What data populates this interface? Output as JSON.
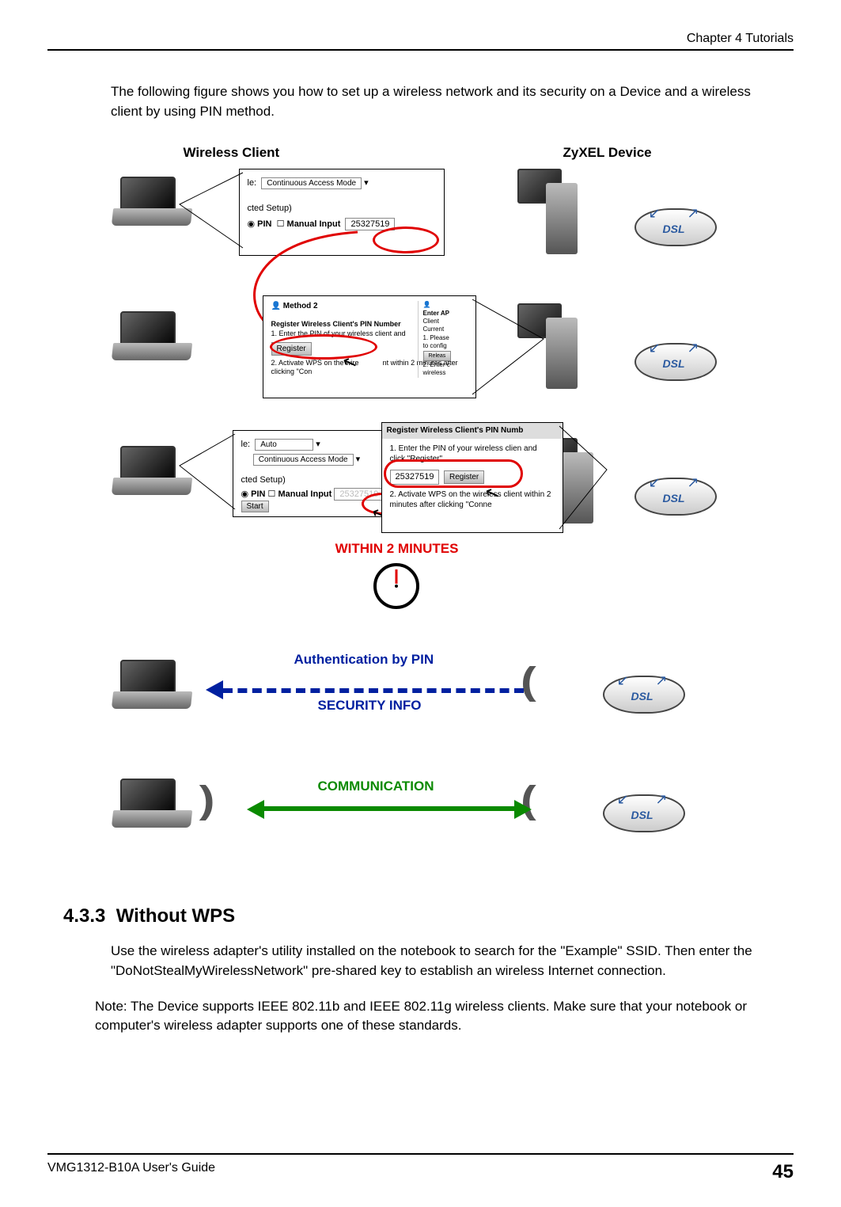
{
  "header": {
    "chapter": "Chapter 4 Tutorials"
  },
  "intro": "The following figure shows you how to set up a wireless network and its security on a Device and a wireless client by using PIN method.",
  "figure": {
    "left_label": "Wireless Client",
    "right_label": "ZyXEL Device",
    "dsl_label": "DSL",
    "callout1": {
      "mode_label": "le:",
      "mode_value": "Continuous Access Mode",
      "setup": "cted Setup)",
      "pin_radio": "PIN",
      "manual_label": "Manual Input",
      "pin_value": "25327519"
    },
    "callout2": {
      "title": "Method 2",
      "sub": "Register Wireless Client's PIN Number",
      "step1": "1. Enter the PIN of your wireless client and",
      "btn": "Register",
      "step2a": "2. Activate WPS on the wire",
      "step2b": "nt within 2 minutes after clicking \"Con",
      "right_top": "Enter AP",
      "right_client": "Client",
      "right_current": "Current",
      "right_please": "1. Please",
      "right_config": "to config",
      "right_release": "Releas",
      "right_enter": "2. Enter c",
      "right_wireless": "wireless"
    },
    "callout3": {
      "mode_label": "le:",
      "auto": "Auto",
      "mode_value": "Continuous Access Mode",
      "setup": "cted Setup)",
      "pin_radio": "PIN",
      "manual_label": "Manual Input",
      "start_btn": "Start"
    },
    "callout4": {
      "title": "Register Wireless Client's PIN Numb",
      "step1": "1. Enter the PIN of your wireless clien and click \"Register\"",
      "pin_value": "25327519",
      "btn": "Register",
      "step2": "2. Activate WPS on the wireless client within 2 minutes after clicking \"Conne"
    },
    "within": "WITHIN 2 MINUTES",
    "auth": "Authentication by PIN",
    "security": "SECURITY INFO",
    "comm": "COMMUNICATION"
  },
  "section": {
    "number": "4.3.3",
    "title": "Without WPS",
    "body": "Use the wireless adapter's utility installed on the notebook to search for the \"Example\" SSID. Then enter the \"DoNotStealMyWirelessNetwork\" pre-shared key to establish an wireless Internet connection.",
    "note": "Note: The Device supports IEEE 802.11b and IEEE 802.11g wireless clients. Make sure that your notebook or computer's wireless adapter supports one of these standards."
  },
  "footer": {
    "guide": "VMG1312-B10A User's Guide",
    "page": "45"
  }
}
